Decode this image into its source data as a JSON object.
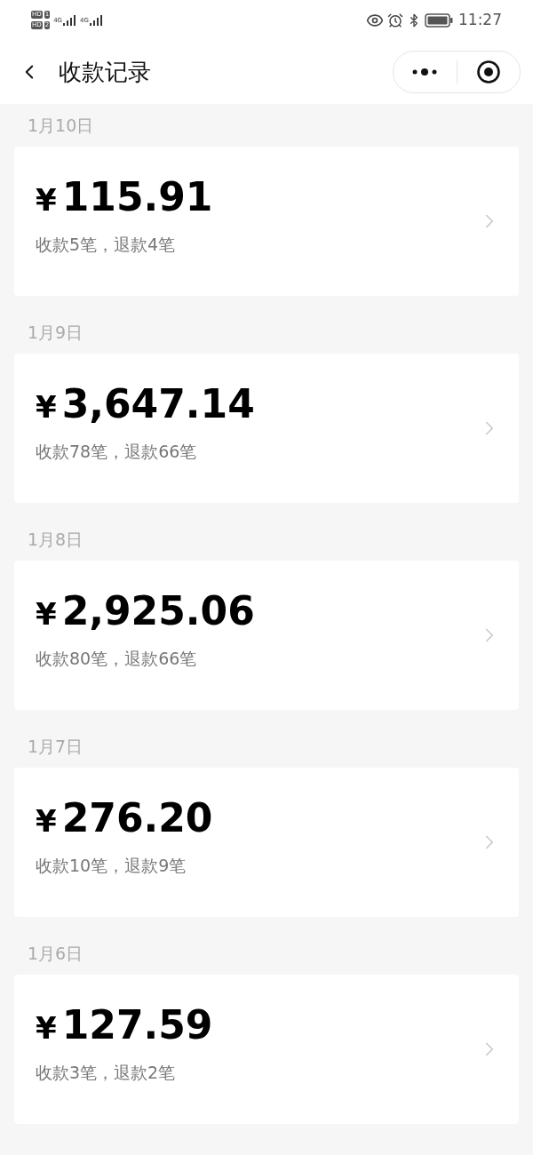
{
  "status_bar": {
    "sim_labels": [
      "HD",
      "HD"
    ],
    "sim_numbers": [
      "1",
      "2"
    ],
    "network": [
      "4G",
      "4G"
    ],
    "time": "11:27"
  },
  "header": {
    "title": "收款记录"
  },
  "days": [
    {
      "date": "1月10日",
      "currency": "¥",
      "amount": "115.91",
      "summary": "收款5笔，退款4笔"
    },
    {
      "date": "1月9日",
      "currency": "¥",
      "amount": "3,647.14",
      "summary": "收款78笔，退款66笔"
    },
    {
      "date": "1月8日",
      "currency": "¥",
      "amount": "2,925.06",
      "summary": "收款80笔，退款66笔"
    },
    {
      "date": "1月7日",
      "currency": "¥",
      "amount": "276.20",
      "summary": "收款10笔，退款9笔"
    },
    {
      "date": "1月6日",
      "currency": "¥",
      "amount": "127.59",
      "summary": "收款3笔，退款2笔"
    }
  ]
}
